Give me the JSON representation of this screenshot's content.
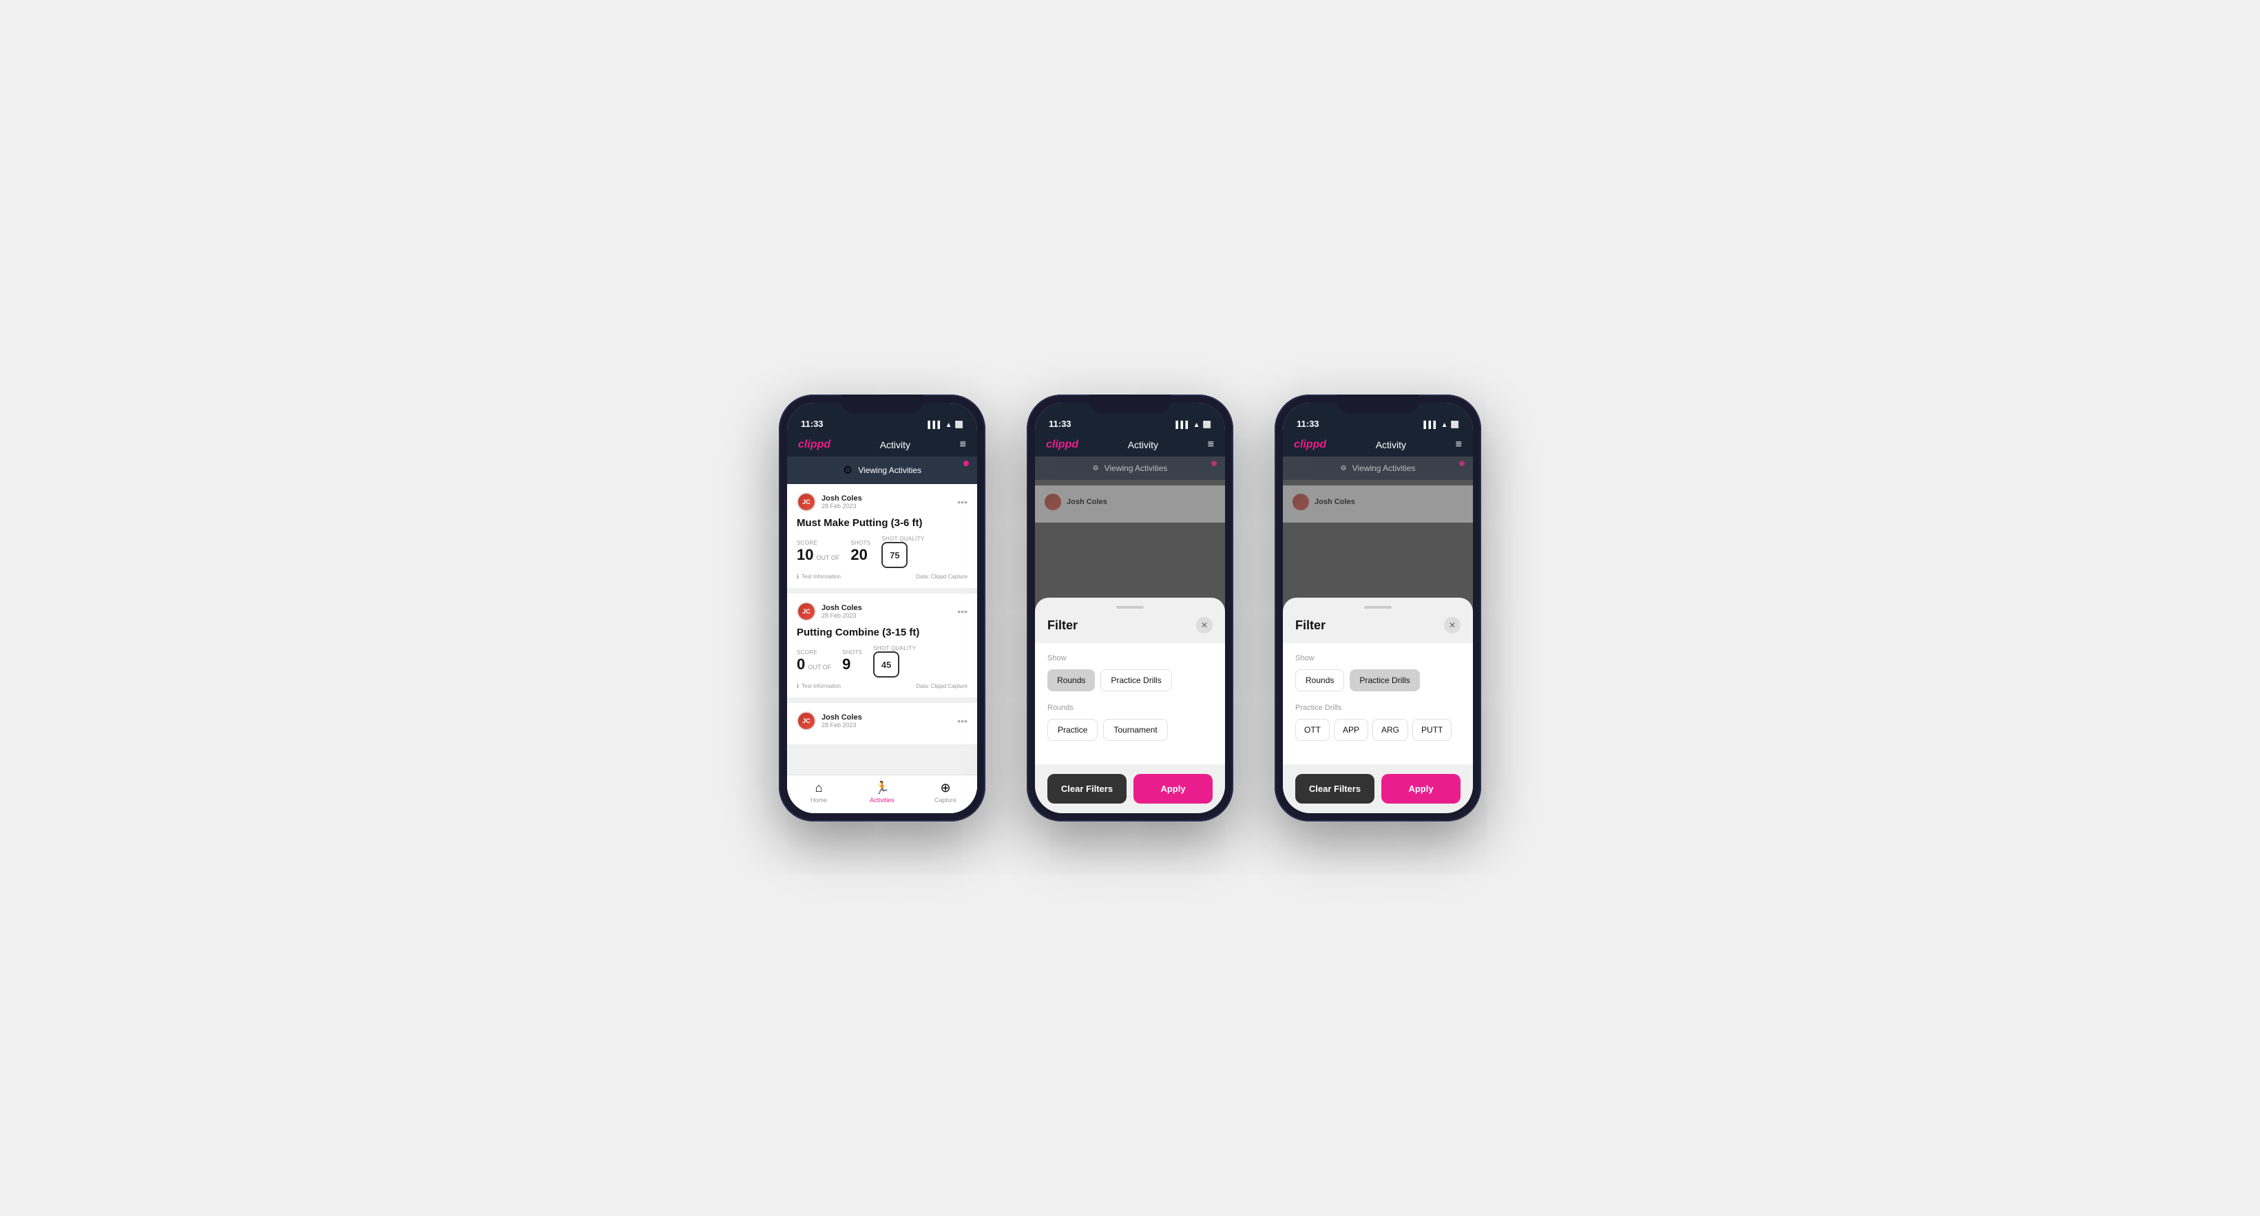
{
  "app": {
    "logo": "clippd",
    "nav_title": "Activity",
    "menu_icon": "≡"
  },
  "status_bar": {
    "time": "11:33",
    "signal": "▌▌▌",
    "wifi": "wifi",
    "battery": "31"
  },
  "viewing_bar": {
    "icon": "⚡",
    "label": "Viewing Activities"
  },
  "phone1": {
    "activities": [
      {
        "user_name": "Josh Coles",
        "user_date": "28 Feb 2023",
        "title": "Must Make Putting (3-6 ft)",
        "score_label": "Score",
        "score_value": "10",
        "out_of_label": "OUT OF",
        "shots_label": "Shots",
        "shots_value": "20",
        "shot_quality_label": "Shot Quality",
        "shot_quality_value": "75",
        "info": "Test Information",
        "source": "Data: Clippd Capture"
      },
      {
        "user_name": "Josh Coles",
        "user_date": "28 Feb 2023",
        "title": "Putting Combine (3-15 ft)",
        "score_label": "Score",
        "score_value": "0",
        "out_of_label": "OUT OF",
        "shots_label": "Shots",
        "shots_value": "9",
        "shot_quality_label": "Shot Quality",
        "shot_quality_value": "45",
        "info": "Test Information",
        "source": "Data: Clippd Capture"
      },
      {
        "user_name": "Josh Coles",
        "user_date": "28 Feb 2023",
        "title": "",
        "score_label": "",
        "score_value": "",
        "out_of_label": "",
        "shots_label": "",
        "shots_value": "",
        "shot_quality_label": "",
        "shot_quality_value": "",
        "info": "",
        "source": ""
      }
    ],
    "bottom_nav": [
      {
        "label": "Home",
        "icon": "🏠",
        "active": false
      },
      {
        "label": "Activities",
        "icon": "🏃",
        "active": true
      },
      {
        "label": "Capture",
        "icon": "⊕",
        "active": false
      }
    ]
  },
  "phone2": {
    "filter": {
      "title": "Filter",
      "show_label": "Show",
      "show_buttons": [
        {
          "label": "Rounds",
          "active": true
        },
        {
          "label": "Practice Drills",
          "active": false
        }
      ],
      "rounds_label": "Rounds",
      "rounds_buttons": [
        {
          "label": "Practice",
          "active": false
        },
        {
          "label": "Tournament",
          "active": false
        }
      ],
      "clear_label": "Clear Filters",
      "apply_label": "Apply"
    }
  },
  "phone3": {
    "filter": {
      "title": "Filter",
      "show_label": "Show",
      "show_buttons": [
        {
          "label": "Rounds",
          "active": false
        },
        {
          "label": "Practice Drills",
          "active": true
        }
      ],
      "drills_label": "Practice Drills",
      "drills_buttons": [
        {
          "label": "OTT",
          "active": false
        },
        {
          "label": "APP",
          "active": false
        },
        {
          "label": "ARG",
          "active": false
        },
        {
          "label": "PUTT",
          "active": false
        }
      ],
      "clear_label": "Clear Filters",
      "apply_label": "Apply"
    }
  }
}
